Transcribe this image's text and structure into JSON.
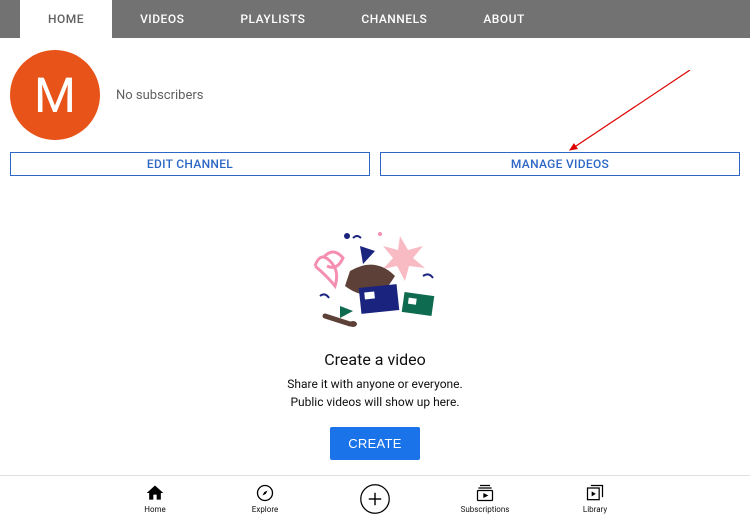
{
  "tabs": {
    "home": "HOME",
    "videos": "VIDEOS",
    "playlists": "PLAYLISTS",
    "channels": "CHANNELS",
    "about": "ABOUT"
  },
  "profile": {
    "avatar_letter": "M",
    "subscribers": "No subscribers"
  },
  "actions": {
    "edit_channel": "EDIT CHANNEL",
    "manage_videos": "MANAGE VIDEOS"
  },
  "empty_state": {
    "title": "Create a video",
    "line1": "Share it with anyone or everyone.",
    "line2": "Public videos will show up here.",
    "button": "CREATE"
  },
  "bottom_nav": {
    "home": "Home",
    "explore": "Explore",
    "subscriptions": "Subscriptions",
    "library": "Library"
  }
}
